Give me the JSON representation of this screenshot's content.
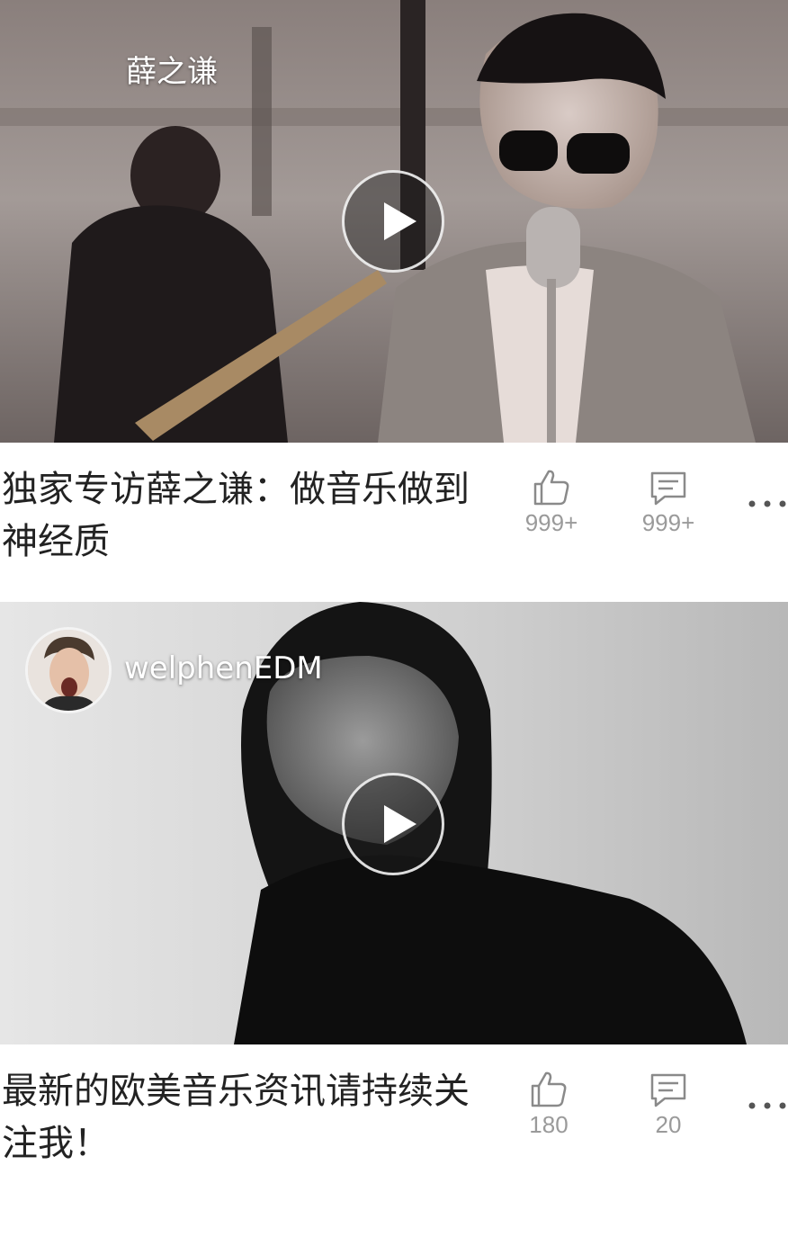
{
  "feed": [
    {
      "author": "薛之谦",
      "has_avatar": false,
      "title": "独家专访薛之谦：做音乐做到神经质",
      "likes": "999+",
      "comments": "999+"
    },
    {
      "author": "welphenEDM",
      "has_avatar": true,
      "title": "最新的欧美音乐资讯请持续关注我！",
      "likes": "180",
      "comments": "20"
    }
  ],
  "icons": {
    "play": "play-icon",
    "like": "thumbs-up-icon",
    "comment": "comment-icon",
    "more": "more-dots-icon"
  },
  "colors": {
    "count_text": "#9a9a9a",
    "title_text": "#222222"
  }
}
